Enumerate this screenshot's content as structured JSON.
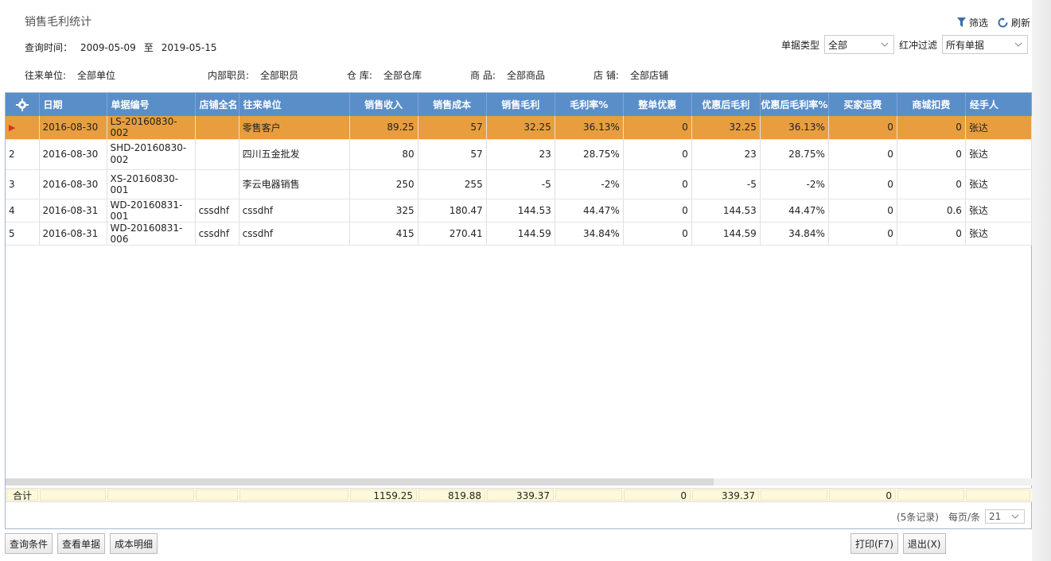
{
  "title": "销售毛利统计",
  "toolbar": {
    "filter": "筛选",
    "refresh": "刷新"
  },
  "query": {
    "time_label": "查询时间：",
    "start": "2009-05-09",
    "to": "至",
    "end": "2019-05-15",
    "doc_type_label": "单据类型",
    "doc_type_value": "全部",
    "red_filter_label": "红冲过滤",
    "red_filter_value": "所有单据",
    "partner_label": "往来单位:",
    "partner_value": "全部单位",
    "staff_label": "内部职员:",
    "staff_value": "全部职员",
    "warehouse_label": "仓 库:",
    "warehouse_value": "全部仓库",
    "goods_label": "商 品:",
    "goods_value": "全部商品",
    "store_label": "店 铺:",
    "store_value": "全部店铺"
  },
  "table": {
    "headers": [
      "日期",
      "单据编号",
      "店铺全名",
      "往来单位",
      "销售收入",
      "销售成本",
      "销售毛利",
      "毛利率%",
      "整单优惠",
      "优惠后毛利",
      "优惠后毛利率%",
      "买家运费",
      "商城扣费",
      "经手人"
    ],
    "rows": [
      [
        "",
        "2016-08-30",
        "LS-20160830-002",
        "",
        "零售客户",
        "89.25",
        "57",
        "32.25",
        "36.13%",
        "0",
        "32.25",
        "36.13%",
        "0",
        "0",
        "张达"
      ],
      [
        "2",
        "2016-08-30",
        "SHD-20160830-002",
        "",
        "四川五金批发",
        "80",
        "57",
        "23",
        "28.75%",
        "0",
        "23",
        "28.75%",
        "0",
        "0",
        "张达"
      ],
      [
        "3",
        "2016-08-30",
        "XS-20160830-001",
        "",
        "李云电器销售",
        "250",
        "255",
        "-5",
        "-2%",
        "0",
        "-5",
        "-2%",
        "0",
        "0",
        "张达"
      ],
      [
        "4",
        "2016-08-31",
        "WD-20160831-001",
        "cssdhf",
        "cssdhf",
        "325",
        "180.47",
        "144.53",
        "44.47%",
        "0",
        "144.53",
        "44.47%",
        "0",
        "0.6",
        "张达"
      ],
      [
        "5",
        "2016-08-31",
        "WD-20160831-006",
        "cssdhf",
        "cssdhf",
        "415",
        "270.41",
        "144.59",
        "34.84%",
        "0",
        "144.59",
        "34.84%",
        "0",
        "0",
        "张达"
      ]
    ]
  },
  "totals": {
    "label": "合计",
    "sales_income": "1159.25",
    "sales_cost": "819.88",
    "gross_profit": "339.37",
    "discount": "0",
    "profit_after_discount": "339.37",
    "buyer_freight": "0"
  },
  "pager": {
    "records": "(5条记录)",
    "per_page_label": "每页/条",
    "per_page_value": "21"
  },
  "buttons": {
    "query_conditions": "查询条件",
    "view_document": "查看单据",
    "cost_detail": "成本明细",
    "print": "打印(F7)",
    "exit": "退出(X)"
  },
  "colors": {
    "header_blue": "#5a8ec9",
    "selected_row": "#e89e3e",
    "arrow_red": "#d13a1f"
  }
}
